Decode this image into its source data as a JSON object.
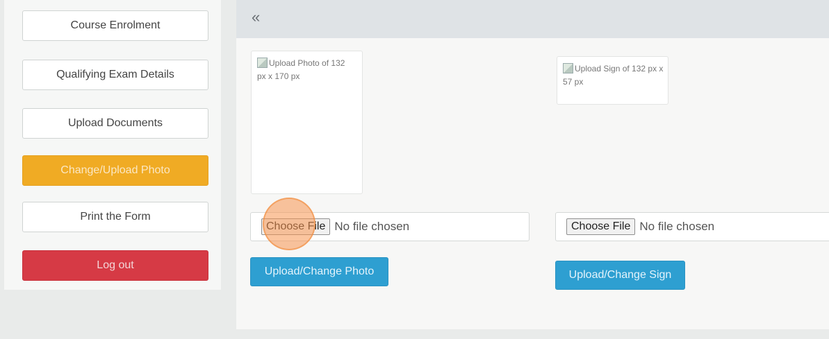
{
  "sidebar": {
    "items": [
      {
        "label": "Course Enrolment"
      },
      {
        "label": "Qualifying Exam Details"
      },
      {
        "label": "Upload Documents"
      },
      {
        "label": "Change/Upload Photo"
      },
      {
        "label": "Print the Form"
      },
      {
        "label": "Log out"
      }
    ]
  },
  "topbar": {
    "collapse_glyph": "«"
  },
  "photo": {
    "alt_text": "Upload Photo of 132 px x 170 px",
    "choose_label": "Choose File",
    "file_status": "No file chosen",
    "upload_button": "Upload/Change Photo"
  },
  "sign": {
    "alt_text": "Upload Sign of 132 px x 57 px",
    "choose_label": "Choose File",
    "file_status": "No file chosen",
    "upload_button": "Upload/Change Sign"
  },
  "colors": {
    "active": "#f0ab24",
    "danger": "#d63a45",
    "primary": "#2e9fd1"
  }
}
